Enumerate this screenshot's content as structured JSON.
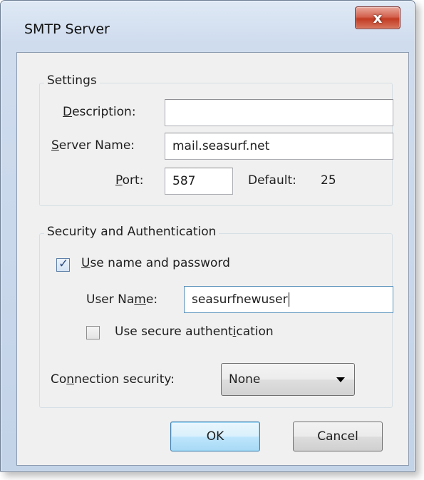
{
  "window": {
    "title": "SMTP Server",
    "close_glyph": "x"
  },
  "settings": {
    "legend": "Settings",
    "description": {
      "label_u": "D",
      "label_rest": "escription:",
      "value": ""
    },
    "server_name": {
      "label_u": "S",
      "label_rest": "erver Name:",
      "value": "mail.seasurf.net"
    },
    "port": {
      "label_u": "P",
      "label_rest": "ort:",
      "value": "587",
      "default_label": "Default:",
      "default_value": "25"
    }
  },
  "security": {
    "legend": "Security and Authentication",
    "use_name_password": {
      "label_u": "U",
      "label_rest": "se name and password",
      "checked": true
    },
    "user_name": {
      "label_pre": "User Na",
      "label_u": "m",
      "label_rest": "e:",
      "value": "seasurfnewuser"
    },
    "secure_auth": {
      "label_pre": "Use secure authent",
      "label_u": "i",
      "label_rest": "cation",
      "checked": false
    },
    "connection_security": {
      "label_pre": "Co",
      "label_u": "n",
      "label_rest": "nection security:",
      "value": "None"
    }
  },
  "buttons": {
    "ok": "OK",
    "cancel": "Cancel"
  }
}
